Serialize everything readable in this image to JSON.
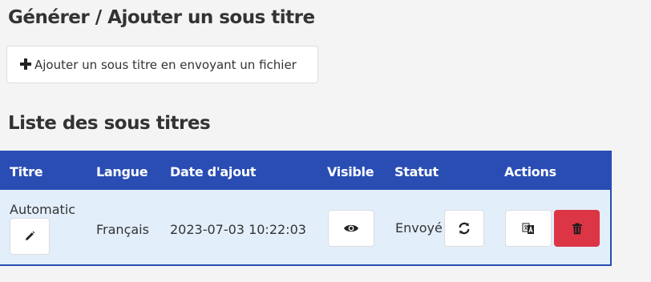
{
  "header": {
    "title": "Générer / Ajouter un sous titre",
    "add_button_label": "Ajouter un sous titre en envoyant un fichier"
  },
  "list": {
    "title": "Liste des sous titres",
    "columns": [
      "Titre",
      "Langue",
      "Date d'ajout",
      "Visible",
      "Statut",
      "Actions"
    ],
    "rows": [
      {
        "titre": "Automatic",
        "langue": "Français",
        "date": "2023-07-03 10:22:03",
        "statut": "Envoyé"
      }
    ]
  },
  "icons": {
    "add": "plus-icon",
    "edit": "pencil-icon",
    "visible": "eye-icon",
    "refresh": "refresh-icon",
    "translate": "translate-icon",
    "delete": "trash-icon"
  },
  "colors": {
    "header_bg": "#2a4db4",
    "row_bg": "#e2eefa",
    "danger": "#dc3545",
    "page_bg": "#f4f4f4"
  }
}
